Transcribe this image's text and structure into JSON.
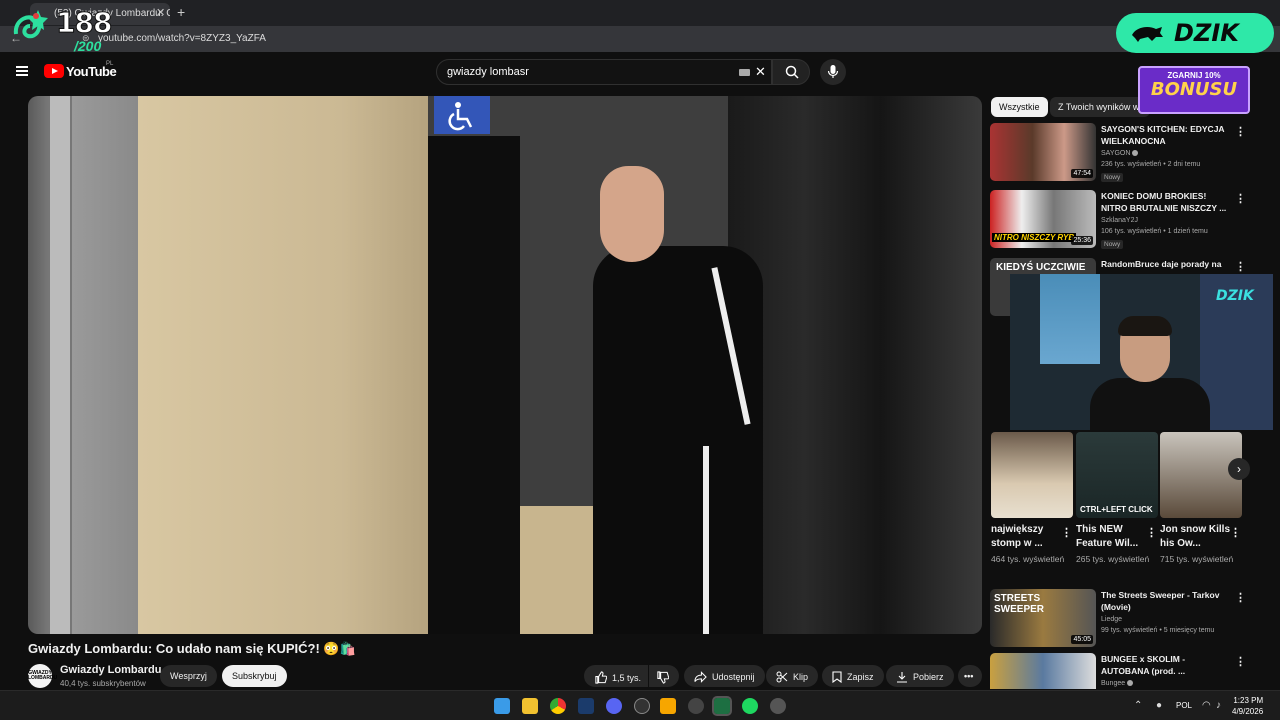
{
  "browser": {
    "tab_title": "(53) Gwiazdy Lombardu: Co udał",
    "url": "youtube.com/watch?v=8ZYZ3_YaZFA"
  },
  "overlay": {
    "counter": "188",
    "counter_total": "/200",
    "brand": "DZIK",
    "bonus_top": "ZGARNIJ 10%",
    "bonus_main": "BONUSU",
    "accent": "#2ee8a8"
  },
  "youtube": {
    "logo_text": "YouTube",
    "country": "PL",
    "search_value": "gwiazdy lombasr"
  },
  "video": {
    "title": "Gwiazdy Lombardu: Co udało nam się KUPIĆ?! 😳🛍️",
    "channel": "Gwiazdy Lombardu",
    "channel_avatar": "GWIAZDY LOMBARDU",
    "subscribers": "40,4 tys. subskrybentów",
    "support_label": "Wesprzyj",
    "subscribe_label": "Subskrybuj",
    "likes": "1,5 tys.",
    "share_label": "Udostępnij",
    "clip_label": "Klip",
    "save_label": "Zapisz",
    "download_label": "Pobierz"
  },
  "sidebar": {
    "chips": [
      "Wszystkie",
      "Z Twoich wyników w"
    ],
    "recommendations": [
      {
        "title": "SAYGON'S KITCHEN: EDYCJA WIELKANOCNA",
        "channel": "SAYGON",
        "verified": true,
        "meta": "236 tys. wyświetleń • 2 dni temu",
        "badge": "Nowy",
        "duration": "47:54",
        "thumb_text": ""
      },
      {
        "title": "KONIEC DOMU BROKIES! NITRO BRUTALNIE NISZCZY ...",
        "channel": "SzklanaY2J",
        "verified": false,
        "meta": "106 tys. wyświetleń • 1 dzień temu",
        "badge": "Nowy",
        "duration": "25:36",
        "thumb_text": "NITRO NISZCZY RYB"
      },
      {
        "title": "RandomBruce daje porady na",
        "channel": "",
        "verified": false,
        "meta": "",
        "badge": "",
        "duration": "",
        "thumb_text": "KIEDYŚ UCZCIWIE"
      }
    ],
    "shorts": [
      {
        "title": "największy stomp w ...",
        "views": "464 tys. wyświetleń",
        "thumb_text": ""
      },
      {
        "title": "This NEW Feature Wil...",
        "views": "265 tys. wyświetleń",
        "thumb_text": "CTRL+LEFT CLICK"
      },
      {
        "title": "Jon snow Kills his Ow...",
        "views": "715 tys. wyświetleń",
        "thumb_text": ""
      }
    ],
    "more_recommendations": [
      {
        "title": "The Streets Sweeper - Tarkov (Movie)",
        "channel": "Liedge",
        "verified": false,
        "meta": "99 tys. wyświetleń • 5 miesięcy temu",
        "badge": "",
        "duration": "45:05",
        "thumb_text": "STREETS SWEEPER"
      },
      {
        "title": "BUNGEE x SKOLIM - AUTOBANA (prod. ...",
        "channel": "Bungee",
        "verified": true,
        "meta": "",
        "badge": "",
        "duration": "",
        "thumb_text": ""
      }
    ]
  },
  "webcam": {
    "logo": "DZIK"
  },
  "taskbar": {
    "lang": "POL",
    "time": "1:23 PM",
    "date": "4/9/2026"
  }
}
